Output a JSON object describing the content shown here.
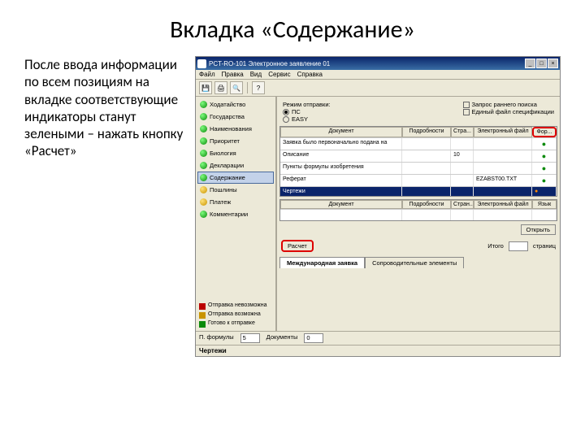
{
  "slide": {
    "title": "Вкладка «Содержание»",
    "body_text": "После ввода информации по всем позициям на вкладке соответствующие индикаторы станут зелеными – нажать кнопку «Расчет»"
  },
  "app": {
    "window_title": "PCT-RO-101 Электронное заявление 01",
    "menu": [
      "Файл",
      "Правка",
      "Вид",
      "Сервис",
      "Справка"
    ],
    "sidebar": [
      {
        "label": "Ходатайство",
        "status": "green"
      },
      {
        "label": "Государства",
        "status": "green"
      },
      {
        "label": "Наименования",
        "status": "green"
      },
      {
        "label": "Приоритет",
        "status": "green"
      },
      {
        "label": "Биология",
        "status": "green"
      },
      {
        "label": "Декларации",
        "status": "green"
      },
      {
        "label": "Содержание",
        "status": "green",
        "selected": true
      },
      {
        "label": "Пошлины",
        "status": "yellow"
      },
      {
        "label": "Платеж",
        "status": "yellow"
      },
      {
        "label": "Комментарии",
        "status": "green"
      }
    ],
    "legend": [
      "Отправка невозможна",
      "Отправка возможна",
      "Готово к отправке"
    ],
    "top": {
      "filing_label": "Режим отправки:",
      "radio1": "ПС",
      "radio2": "EASY",
      "chk1": "Запрос раннего поиска",
      "chk2": "Единый файл спецификации"
    },
    "table1": {
      "headers": [
        "Документ",
        "Подробности",
        "Стра...",
        "Электронный файл",
        "Фор..."
      ],
      "rows": [
        {
          "doc": "Заявка было первоначально подана на",
          "pages": "",
          "efile": "",
          "status": "green"
        },
        {
          "doc": "Описание",
          "pages": "10",
          "efile": "",
          "status": "green"
        },
        {
          "doc": "Пункты формулы изобретения",
          "pages": "",
          "efile": "",
          "status": "green"
        },
        {
          "doc": "Реферат",
          "pages": "",
          "efile": "EZABST00.TXT",
          "status": "green"
        },
        {
          "doc": "Чертежи",
          "pages": "",
          "efile": "",
          "status": "orange",
          "selected": true
        }
      ]
    },
    "table2": {
      "headers": [
        "Документ",
        "Подробности",
        "Стран...",
        "Электронный файл",
        "Язык"
      ]
    },
    "buttons": {
      "open": "Открыть",
      "calc": "Расчет"
    },
    "footer": {
      "total_label": "Итого",
      "pages_unit": "страниц"
    },
    "tabs": [
      "Международная заявка",
      "Сопроводительные элементы"
    ],
    "status": {
      "claims_label": "П. формулы",
      "claims_val": "5",
      "drawings_label": "Документы",
      "drawings_val": "0"
    },
    "drawings_section": "Чертежи"
  }
}
